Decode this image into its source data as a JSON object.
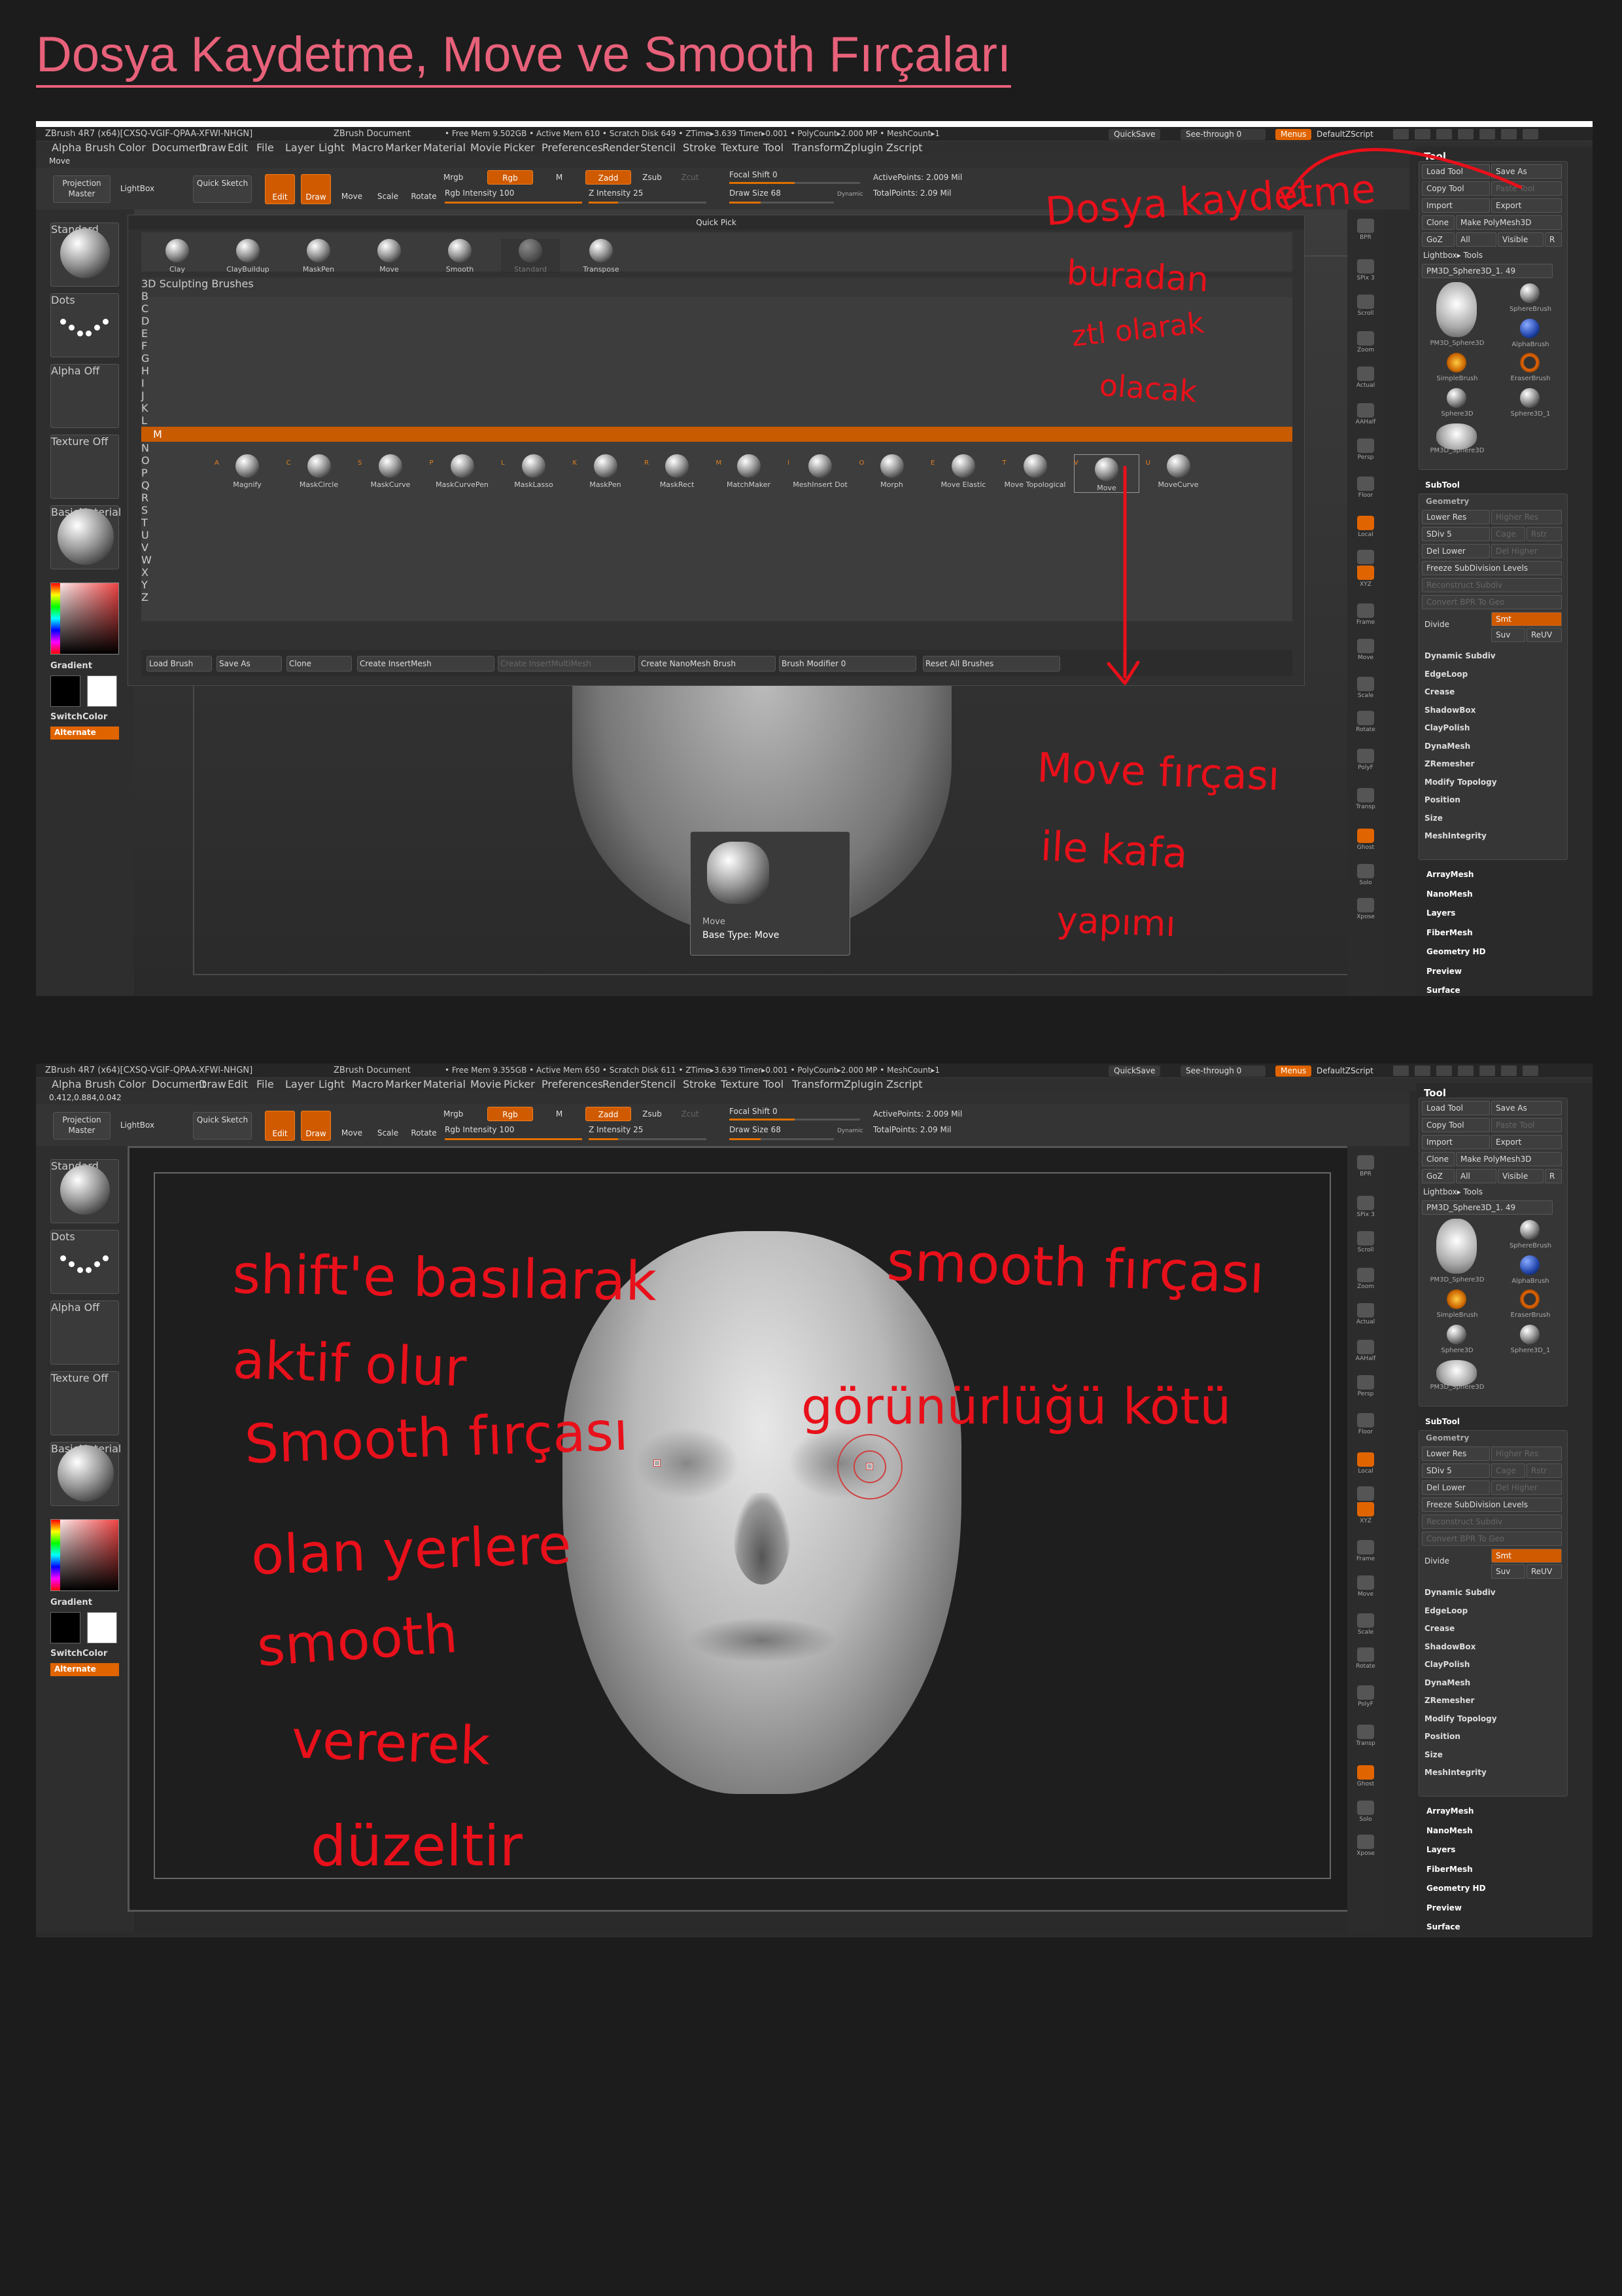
{
  "page": {
    "title": "Dosya Kaydetme, Move ve Smooth Fırçaları"
  },
  "top": {
    "titlebar": {
      "app": "ZBrush 4R7 (x64)[CXSQ-VGIF-QPAA-XFWI-NHGN]",
      "doc": "ZBrush Document",
      "stats": "• Free Mem 9.502GB • Active Mem 610 • Scratch Disk 649 • ZTime▸3.639 Timer▸0.001 • PolyCount▸2.000 MP • MeshCount▸1",
      "quicksave": "QuickSave",
      "seethrough": "See-through 0",
      "menus": "Menus",
      "script": "DefaultZScript"
    },
    "status": "Move",
    "quickpick": {
      "title": "Quick Pick",
      "brushes": [
        "Clay",
        "ClayBuildup",
        "MaskPen",
        "Move",
        "Smooth",
        "Standard",
        "Transpose"
      ],
      "library_title": "3D Sculpting Brushes",
      "letters": [
        "B",
        "C",
        "D",
        "E",
        "F",
        "G",
        "H",
        "I",
        "J",
        "K",
        "L",
        "M",
        "N",
        "O",
        "P",
        "Q",
        "R",
        "S",
        "T",
        "U",
        "V",
        "W",
        "X",
        "Y",
        "Z"
      ],
      "lib_brushes": [
        "Magnify",
        "MaskCircle",
        "MaskCurve",
        "MaskCurvePen",
        "MaskLasso",
        "MaskPen",
        "MaskRect",
        "MatchMaker",
        "MeshInsert Dot",
        "Morph",
        "Move Elastic",
        "Move Topological",
        "Move",
        "MoveCurve"
      ],
      "lib_letters": [
        "A",
        "C",
        "S",
        "P",
        "L",
        "K",
        "R",
        "M",
        "I",
        "O",
        "E",
        "T",
        "V",
        "U"
      ],
      "footer": {
        "load": "Load Brush",
        "save": "Save As",
        "clone": "Clone",
        "insertmesh": "Create InsertMesh",
        "insertmulti": "Create InsertMultiMesh",
        "nanomesh": "Create NanoMesh Brush",
        "modifier": "Brush Modifier 0",
        "reset": "Reset All Brushes"
      }
    },
    "card": {
      "name": "Move",
      "base": "Base Type: Move"
    },
    "annotations": [
      "Dosya kaydetme",
      "buradan",
      "ztl olarak",
      "olacak",
      "Move fırçası",
      "ile kafa",
      "yapımı"
    ]
  },
  "bottom": {
    "titlebar": {
      "app": "ZBrush 4R7 (x64)[CXSQ-VGIF-QPAA-XFWI-NHGN]",
      "doc": "ZBrush Document",
      "stats": "• Free Mem 9.355GB • Active Mem 650 • Scratch Disk 611 • ZTime▸3.639 Timer▸0.001 • PolyCount▸2.000 MP • MeshCount▸1",
      "quicksave": "QuickSave",
      "seethrough": "See-through 0",
      "menus": "Menus",
      "script": "DefaultZScript"
    },
    "status": "0.412,0.884,0.042",
    "annotations": [
      "shift'e basılarak",
      "smooth fırçası",
      "aktif olur",
      "Smooth fırçası",
      "görünürlüğü kötü",
      "olan yerlere",
      "smooth",
      "vererek",
      "düzeltir"
    ]
  },
  "menubar": [
    "Alpha",
    "Brush",
    "Color",
    "Document",
    "Draw",
    "Edit",
    "File",
    "Layer",
    "Light",
    "Macro",
    "Marker",
    "Material",
    "Movie",
    "Picker",
    "Preferences",
    "Render",
    "Stencil",
    "Stroke",
    "Texture",
    "Tool",
    "Transform",
    "Zplugin",
    "Zscript"
  ],
  "shelf": {
    "projection": "Projection Master",
    "lightbox": "LightBox",
    "quicksketch": "Quick Sketch",
    "edit": "Edit",
    "draw": "Draw",
    "move": "Move",
    "scale": "Scale",
    "rotate": "Rotate",
    "mrgb": "Mrgb",
    "rgb": "Rgb",
    "m": "M",
    "zadd": "Zadd",
    "zsub": "Zsub",
    "zcut": "Zcut",
    "rgb_int": "Rgb Intensity 100",
    "z_int": "Z Intensity 25",
    "focal": "Focal Shift 0",
    "drawsize": "Draw Size 68",
    "dynamic": "Dynamic",
    "active": "ActivePoints: 2.009 Mil",
    "total": "TotalPoints: 2.09 Mil"
  },
  "left": {
    "brush": "Standard",
    "stroke": "Dots",
    "alpha": "Alpha Off",
    "texture": "Texture Off",
    "material": "BasicMaterial",
    "gradient": "Gradient",
    "switch": "SwitchColor",
    "alternate": "Alternate"
  },
  "right_icons": [
    "BPR",
    "SPix 3",
    "Scroll",
    "Zoom",
    "Actual",
    "AAHalf",
    "Persp",
    "Floor",
    "Local",
    "L.Sym",
    "XYZ",
    "Frame",
    "Move",
    "Scale",
    "Rotate",
    "PolyF",
    "Transp",
    "Ghost",
    "Solo",
    "Xpose"
  ],
  "tool": {
    "title": "Tool",
    "load": "Load Tool",
    "saveas": "Save As",
    "copy": "Copy Tool",
    "paste": "Paste Tool",
    "import": "Import",
    "export": "Export",
    "clone": "Clone",
    "makepoly": "Make PolyMesh3D",
    "goz": "GoZ",
    "all": "All",
    "visible": "Visible",
    "r": "R",
    "lightbox": "Lightbox▸ Tools",
    "current": "PM3D_Sphere3D_1. 49",
    "items": [
      "PM3D_Sphere3D",
      "SphereBrush",
      "AlphaBrush",
      "SimpleBrush",
      "EraserBrush",
      "Sphere3D",
      "Sphere3D_1",
      "PM3D_Sphere3D"
    ],
    "subtool": "SubTool",
    "geometry": "Geometry",
    "lowerres": "Lower Res",
    "higherres": "Higher Res",
    "sdiv": "SDiv 5",
    "cage": "Cage",
    "rstr": "Rstr",
    "dellower": "Del Lower",
    "delhigher": "Del Higher",
    "freeze": "Freeze SubDivision Levels",
    "reconstruct": "Reconstruct Subdiv",
    "convert": "Convert BPR To Geo",
    "divide": "Divide",
    "smt": "Smt",
    "suv": "Suv",
    "reuv": "ReUV",
    "geo_items": [
      "Dynamic Subdiv",
      "EdgeLoop",
      "Crease",
      "ShadowBox",
      "ClayPolish",
      "DynaMesh",
      "ZRemesher",
      "Modify Topology",
      "Position",
      "Size",
      "MeshIntegrity"
    ],
    "menus": [
      "ArrayMesh",
      "NanoMesh",
      "Layers",
      "FiberMesh",
      "Geometry HD",
      "Preview",
      "Surface"
    ]
  }
}
